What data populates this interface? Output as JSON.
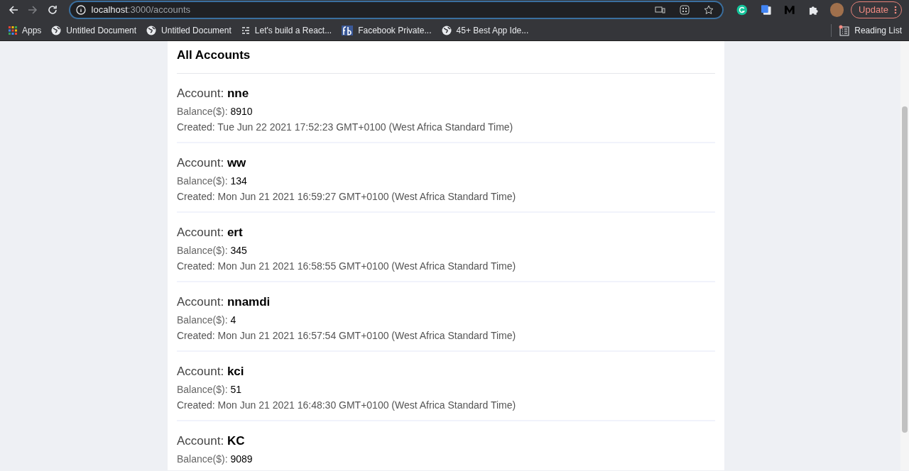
{
  "browser": {
    "url_host": "localhost",
    "url_path": ":3000/accounts",
    "update_button": "Update",
    "bookmarks": [
      {
        "kind": "apps",
        "label": "Apps"
      },
      {
        "kind": "globe",
        "label": "Untitled Document"
      },
      {
        "kind": "globe",
        "label": "Untitled Document"
      },
      {
        "kind": "list",
        "label": "Let's build a React..."
      },
      {
        "kind": "fb",
        "label": "Facebook Private..."
      },
      {
        "kind": "globe",
        "label": "45+ Best App Ide..."
      }
    ],
    "reading_list": "Reading List"
  },
  "page": {
    "title": "All Accounts",
    "accounts": [
      {
        "name": "Account: **nne**",
        "balance": "Balance($): **8910**",
        "created": "Created: Tue Jun 22 2021 17:52:23 GMT+0100 (West Africa Standard Time)"
      },
      {
        "name": "Account: **ww**",
        "balance": "Balance($): **134**",
        "created": "Created: Mon Jun 21 2021 16:59:27 GMT+0100 (West Africa Standard Time)"
      },
      {
        "name": "Account: **ert**",
        "balance": "Balance($): **345**",
        "created": "Created: Mon Jun 21 2021 16:58:55 GMT+0100 (West Africa Standard Time)"
      },
      {
        "name": "Account: **nnamdi**",
        "balance": "Balance($): **4**",
        "created": "Created: Mon Jun 21 2021 16:57:54 GMT+0100 (West Africa Standard Time)"
      },
      {
        "name": "Account: **kci**",
        "balance": "Balance($): **51**",
        "created": "Created: Mon Jun 21 2021 16:48:30 GMT+0100 (West Africa Standard Time)"
      },
      {
        "name": "Account: **KC**",
        "balance": "Balance($): **9089**"
      }
    ]
  }
}
